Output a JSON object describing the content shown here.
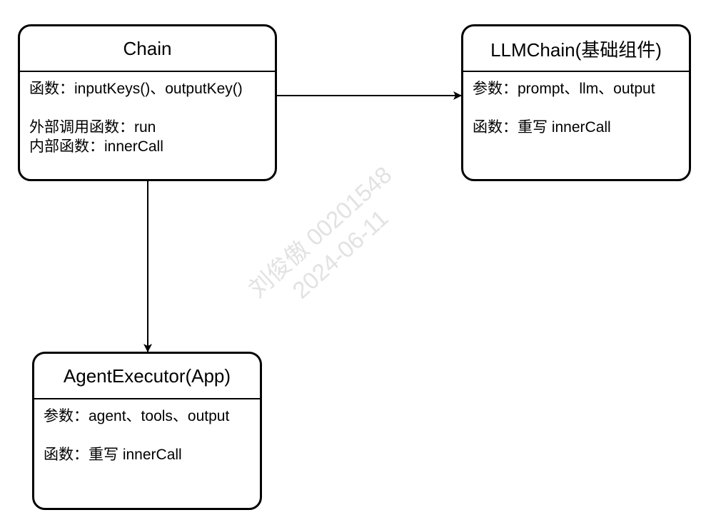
{
  "nodes": {
    "chain": {
      "title": "Chain",
      "line1": "函数：inputKeys()、outputKey()",
      "line2": "外部调用函数：run",
      "line3": "内部函数：innerCall"
    },
    "llmchain": {
      "title": "LLMChain(基础组件)",
      "line1": "参数：prompt、llm、output",
      "line2": "函数：重写 innerCall"
    },
    "agent_executor": {
      "title": "AgentExecutor(App)",
      "line1": "参数：agent、tools、output",
      "line2": "函数：重写 innerCall"
    }
  },
  "watermark": {
    "line1": "刘俊傲 00201548",
    "line2": "2024-06-11"
  }
}
